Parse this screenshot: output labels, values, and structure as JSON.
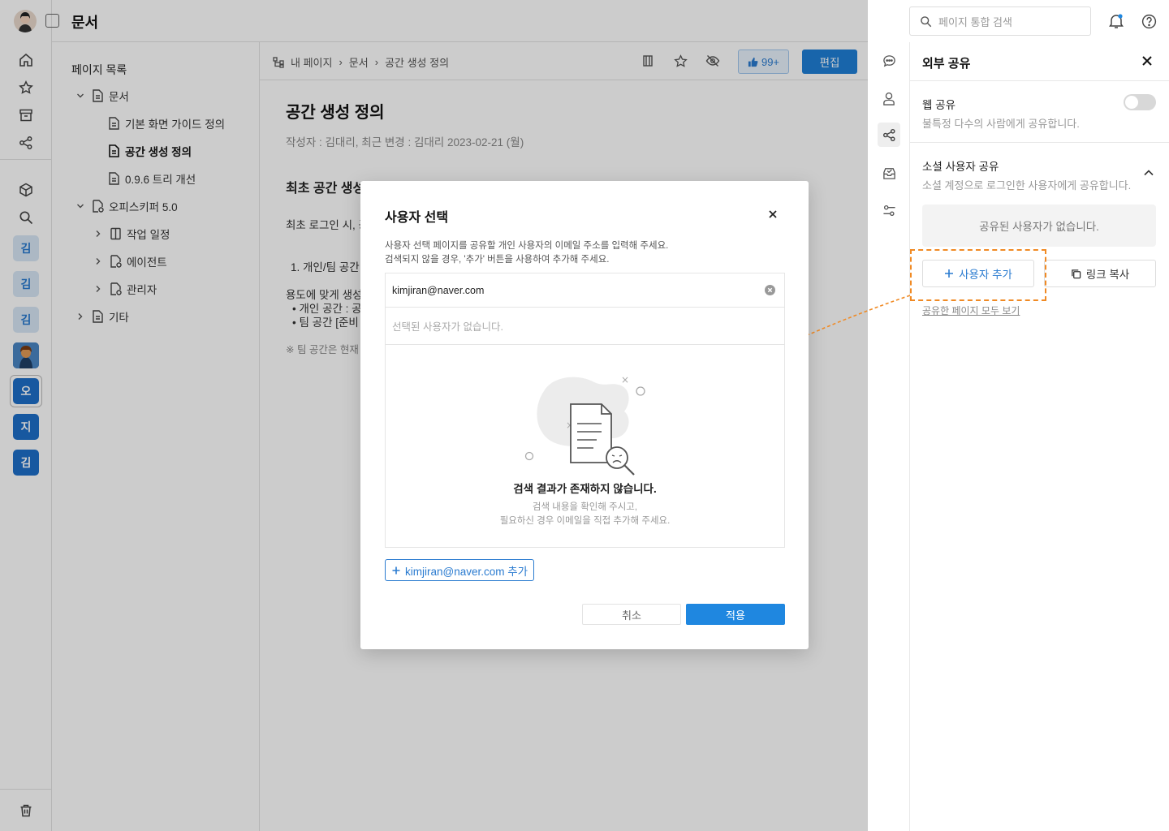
{
  "app": {
    "title": "문서"
  },
  "tree": {
    "heading": "페이지 목록",
    "items": [
      {
        "label": "문서"
      },
      {
        "label": "기본 화면 가이드 정의"
      },
      {
        "label": "공간 생성 정의"
      },
      {
        "label": "0.9.6 트리 개선"
      },
      {
        "label": "오피스키퍼 5.0"
      },
      {
        "label": "작업 일정"
      },
      {
        "label": "에이전트"
      },
      {
        "label": "관리자"
      },
      {
        "label": "기타"
      }
    ]
  },
  "rail": {
    "avatars": [
      "김",
      "김",
      "김",
      "오",
      "지",
      "김"
    ]
  },
  "breadcrumb": {
    "items": [
      "내 페이지",
      "문서",
      "공간 생성 정의"
    ]
  },
  "toolbar": {
    "like_count": "99+",
    "edit_label": "편집"
  },
  "doc": {
    "title": "공간 생성 정의",
    "meta": "작성자 : 김대리,  최근 변경 : 김대리  2023-02-21 (월)",
    "h2": "최초 공간 생성하기",
    "p1": "최초 로그인 시, 공",
    "p2": "1. 개인/팀 공간",
    "p3": "용도에 맞게 생성",
    "p4": "• 개인 공간 : 공",
    "p5": "• 팀 공간 [준비",
    "p6": "※ 팀 공간은 현재"
  },
  "search": {
    "placeholder": "페이지 통합 검색"
  },
  "panel": {
    "title": "외부 공유",
    "web_share_label": "웹 공유",
    "web_share_desc": "불특정 다수의 사람에게 공유합니다.",
    "social_label": "소셜 사용자 공유",
    "social_desc": "소셜 계정으로 로그인한 사용자에게 공유합니다.",
    "empty_users": "공유된 사용자가 없습니다.",
    "add_user": "사용자 추가",
    "copy_link": "링크 복사",
    "view_all": "공유한 페이지 모두 보기",
    "web_share_on": false
  },
  "modal": {
    "title": "사용자 선택",
    "desc1": "사용자 선택 페이지를 공유할 개인 사용자의 이메일 주소를 입력해 주세요.",
    "desc2": "검색되지 않을 경우, '추가' 버튼을 사용하여 추가해 주세요.",
    "email_value": "kimjiran@naver.com",
    "no_selected": "선택된 사용자가 없습니다.",
    "empty_title": "검색 결과가 존재하지 않습니다.",
    "empty_sub1": "검색 내용을 확인해 주시고,",
    "empty_sub2": "필요하신 경우 이메일을 직접 추가해 주세요.",
    "add_chip": "kimjiran@naver.com 추가",
    "cancel": "취소",
    "apply": "적용"
  },
  "colors": {
    "accent": "#1f87e0",
    "highlight": "#f08a24"
  }
}
